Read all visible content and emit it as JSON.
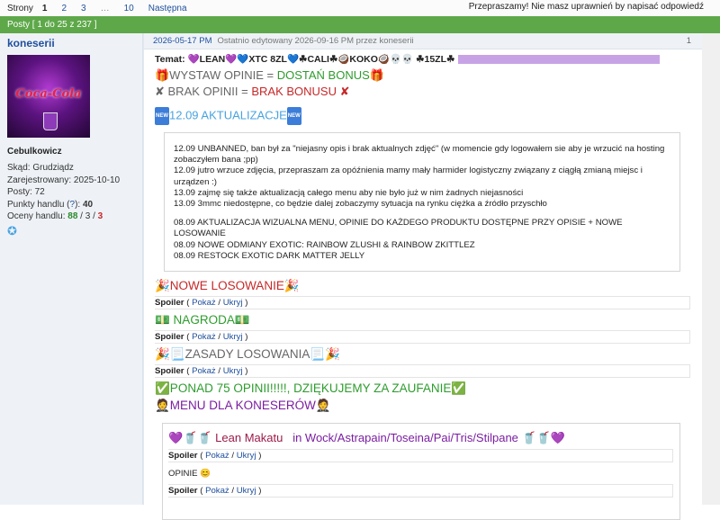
{
  "topbar": {
    "label": "Strony",
    "pages": [
      "1",
      "2",
      "3",
      "…",
      "10"
    ],
    "current": "1",
    "next": "Następna",
    "no_permission": "Przepraszamy! Nie masz uprawnień by napisać odpowiedź"
  },
  "posts_bar": "Posty [ 1 do 25 z 237 ]",
  "user": {
    "name": "koneserii",
    "avatar_text": "Coca-Cola",
    "rank": "Cebulkowicz",
    "location": "Skąd: Grudziądz",
    "registered": "Zarejestrowany: 2025-10-10",
    "posts": "Posty: 72",
    "trade_points_label": "Punkty handlu (",
    "trade_points_q": "?",
    "trade_points_end": "): ",
    "trade_points_val": "40",
    "ratings_label": "Oceny handlu: ",
    "ratings_pos": "88",
    "ratings_sep1": " / ",
    "ratings_neu": "3",
    "ratings_sep2": " / ",
    "ratings_neg": "3",
    "star": "✪"
  },
  "post": {
    "date": "2026-05-17 PM",
    "edited": "Ostatnio edytowany 2026-09-16 PM przez koneserii",
    "number": "1",
    "subject_label": "Temat:",
    "subject": "💜LEAN💜💙XTC 8ZL💙☘CALI☘🥥KOKO🥥💀💀 ☘15ZL☘",
    "line1_a": "🎁WYSTAW OPINIE = ",
    "line1_b": "DOSTAŃ BONUS",
    "line1_c": "🎁",
    "line2_a": "✘ BRAK OPINII = ",
    "line2_b": "BRAK BONUSU",
    "line2_c": " ✘",
    "update_badge": "NEW",
    "update_title": "12.09 AKTUALIZACJE",
    "quote_lines_1": [
      "12.09 UNBANNED, ban był za \"niejasny opis i brak aktualnych zdjęć\" (w momencie gdy logowałem sie aby je wrzucić na hosting zobaczyłem bana ;pp)",
      "12.09 jutro wrzuce zdjęcia, przepraszam za opóźnienia mamy mały harmider logistyczny związany z ciągłą zmianą miejsc i urządzen :)",
      "13.09 zajmę się także aktualizacją całego menu aby nie było już w nim żadnych niejasności",
      "13.09 3mmc niedostępne, co będzie dalej zobaczymy sytuacja na rynku ciężka a źródło przyschło"
    ],
    "quote_lines_2": [
      "08.09 AKTUALIZACJA WIZUALNA MENU, OPINIE DO KAŻDEGO PRODUKTU DOSTĘPNE PRZY OPISIE + NOWE LOSOWANIE",
      "08.09 NOWE ODMIANY EXOTIC: RAINBOW ZLUSHI & RAINBOW ZKITTLEZ",
      "08.09 RESTOCK EXOTIC DARK MATTER JELLY"
    ],
    "losowanie": "🎉NOWE LOSOWANIE🎉",
    "nagroda": "💵 NAGRODA💵",
    "zasady": "🎉📃ZASADY LOSOWANIA📃🎉",
    "ponad": "✅PONAD 75 OPINII!!!!!, DZIĘKUJEMY ZA ZAUFANIE✅",
    "menu": "🤵MENU DLA KONESERÓW🤵",
    "spoiler": {
      "label": "Spoiler",
      "open": " ( ",
      "show": "Pokaż",
      "slash": " / ",
      "hide": "Ukryj",
      "close": " )"
    },
    "lean_icons": "💜🥤🥤 ",
    "lean_name": "Lean Makatu",
    "lean_loc": "in Wock/Astrapain/Toseina/Pai/Tris/Stilpane",
    "lean_icons_end": " 🥤🥤💜",
    "opinie": "OPINIE 😊"
  },
  "colors": {
    "green_bar": "#5ea84a",
    "link": "#1f4f9c",
    "red": "#c62828",
    "green": "#2e9c2e",
    "sidebar": "#eef2f7"
  }
}
